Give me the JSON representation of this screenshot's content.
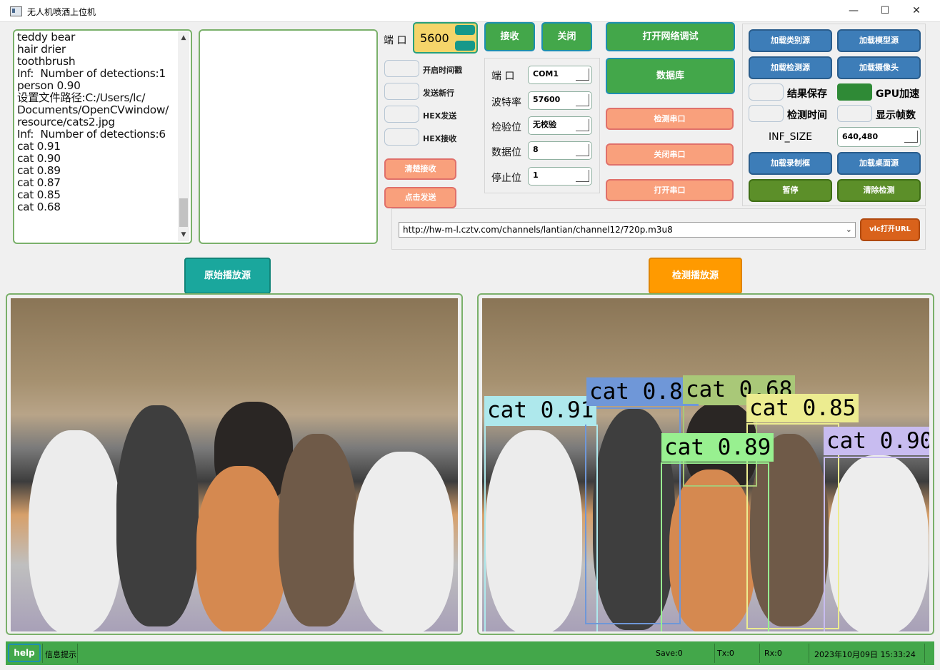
{
  "window": {
    "title": "无人机喷洒上位机",
    "controls": {
      "minimize": "—",
      "maximize": "☐",
      "close": "✕"
    }
  },
  "log": {
    "lines": "teddy bear\nhair drier\ntoothbrush\nInf:  Number of detections:1\nperson 0.90\n设置文件路径:C:/Users/lc/\nDocuments/OpenCVwindow/\nresource/cats2.jpg\nInf:  Number of detections:6\ncat 0.91\ncat 0.90\ncat 0.89\ncat 0.87\ncat 0.85\ncat 0.68"
  },
  "network": {
    "port_label": "端  口",
    "port_value": "5600",
    "receive": "接收",
    "close": "关闭",
    "open_timestamp": "开启时间戳",
    "send_newline": "发送新行",
    "hex_send": "HEX发送",
    "hex_receive": "HEX接收",
    "clear_receive": "清楚接收",
    "click_send": "点击发送"
  },
  "serial": {
    "port_label": "端  口",
    "port_value": "COM1",
    "baud_label": "波特率",
    "baud_value": "57600",
    "parity_label": "检验位",
    "parity_value": "无校验",
    "databits_label": "数据位",
    "databits_value": "8",
    "stopbits_label": "停止位",
    "stopbits_value": "1"
  },
  "center_buttons": {
    "open_net_debug": "打开网络调试",
    "database": "数据库",
    "check_serial": "检测串口",
    "close_serial": "关闭串口",
    "open_serial": "打开串口"
  },
  "right_panel": {
    "load_class_source": "加载类别源",
    "load_model_source": "加载模型源",
    "load_detect_source": "加载检测源",
    "load_camera": "加载摄像头",
    "result_save": "结果保存",
    "gpu_accel": "GPU加速",
    "detect_time": "检测时间",
    "show_fps": "显示帧数",
    "inf_size_label": "INF_SIZE",
    "inf_size_value": "640,480",
    "load_record_box": "加载录制框",
    "load_desktop_source": "加载桌面源",
    "pause": "暂停",
    "clear_detect": "清除检测"
  },
  "url_bar": {
    "url": "http://hw-m-l.cztv.com/channels/lantian/channel12/720p.m3u8",
    "vlc_open": "vlc打开URL"
  },
  "views": {
    "original_source": "原始播放源",
    "detect_source": "检测播放源"
  },
  "detections": [
    {
      "label": "cat 0.91",
      "color": "#aee8ec"
    },
    {
      "label": "cat 0.87",
      "color": "#6f97d8"
    },
    {
      "label": "cat 0.68",
      "color": "#a9c878"
    },
    {
      "label": "cat 0.85",
      "color": "#ecec90"
    },
    {
      "label": "cat 0.89",
      "color": "#98f090"
    },
    {
      "label": "cat 0.90",
      "color": "#c8bcf0"
    }
  ],
  "status": {
    "help": "help",
    "info": "信息提示",
    "save": "Save:0",
    "tx": "Tx:0",
    "rx": "Rx:0",
    "datetime": "2023年10月09日 15:33:24"
  },
  "colors": {
    "green": "#43a74a",
    "orange": "#f9a07c",
    "blue": "#3d7db8",
    "olive": "#5c8f29",
    "teal": "#1aa79d",
    "amber": "#ff9a00",
    "yellow_input": "#f5d56a"
  }
}
